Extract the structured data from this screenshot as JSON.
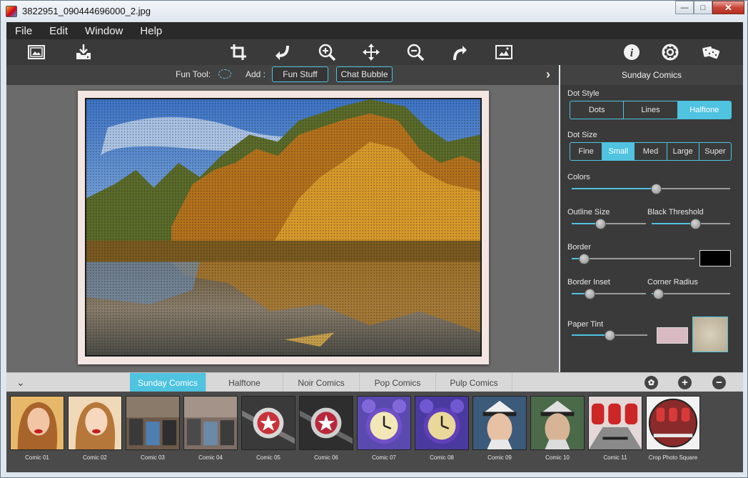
{
  "window": {
    "title": "3822951_090444696000_2.jpg",
    "minimize": "—",
    "maximize": "□",
    "close": "✕"
  },
  "menu": [
    "File",
    "Edit",
    "Window",
    "Help"
  ],
  "toolbar": {
    "left": [
      "open-image-icon",
      "save-image-icon"
    ],
    "center": [
      "crop-icon",
      "rotate-left-icon",
      "zoom-in-icon",
      "move-icon",
      "zoom-out-icon",
      "rotate-right-icon",
      "fit-image-icon"
    ],
    "right": [
      "info-icon",
      "settings-icon",
      "dice-icon"
    ]
  },
  "funbar": {
    "fun_tool_label": "Fun Tool:",
    "add_label": "Add :",
    "fun_stuff": "Fun Stuff",
    "chat_bubble": "Chat Bubble",
    "arrow": "›"
  },
  "panel": {
    "title": "Sunday Comics",
    "dot_style_label": "Dot Style",
    "dot_style": [
      "Dots",
      "Lines",
      "Halftone"
    ],
    "dot_style_selected": "Halftone",
    "dot_size_label": "Dot Size",
    "dot_size": [
      "Fine",
      "Small",
      "Med",
      "Large",
      "Super"
    ],
    "dot_size_selected": "Small",
    "colors_label": "Colors",
    "colors": 0.53,
    "outline_size_label": "Outline Size",
    "outline_size": 0.38,
    "black_threshold_label": "Black Threshold",
    "black_threshold": 0.55,
    "border_label": "Border",
    "border": 0.1,
    "border_color": "#000000",
    "border_inset_label": "Border Inset",
    "border_inset": 0.24,
    "corner_radius_label": "Corner Radius",
    "corner_radius": 0.08,
    "paper_tint_label": "Paper Tint",
    "paper_tint": 0.5,
    "paper_tint_color": "#d9b9c2"
  },
  "style_tabs": [
    "Sunday Comics",
    "Halftone",
    "Noir Comics",
    "Pop Comics",
    "Pulp Comics"
  ],
  "style_tab_active": "Sunday Comics",
  "presets": [
    "Comic 01",
    "Comic 02",
    "Comic 03",
    "Comic 04",
    "Comic 05",
    "Comic 06",
    "Comic 07",
    "Comic 08",
    "Comic 09",
    "Comic 10",
    "Comic 11",
    "Crop Photo Square"
  ],
  "accent": "#4fc3e0"
}
